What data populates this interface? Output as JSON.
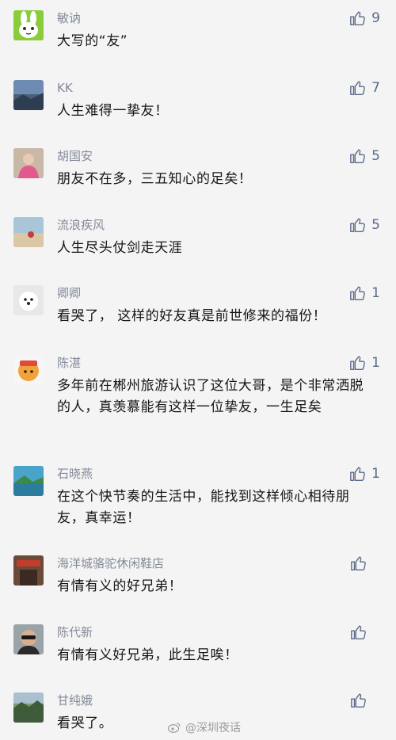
{
  "colors": {
    "background": "#f4f4f4",
    "name": "#848a99",
    "text": "#151515",
    "like": "#5a6a8a"
  },
  "comments": [
    {
      "name": "敏讷",
      "text": "大写的“友”",
      "likes": "9",
      "avatar_icon": "rabbit-avatar"
    },
    {
      "name": "KK",
      "text": "人生难得一挚友！",
      "likes": "7",
      "avatar_icon": "landscape-avatar"
    },
    {
      "name": "胡国安",
      "text": "朋友不在多，三五知心的足矣！",
      "likes": "5",
      "avatar_icon": "person-avatar"
    },
    {
      "name": "流浪疾风",
      "text": "人生尽头仗剑走天涯",
      "likes": "5",
      "avatar_icon": "beach-avatar"
    },
    {
      "name": "卿卿",
      "text": "看哭了，  这样的好友真是前世修来的福份！",
      "likes": "1",
      "avatar_icon": "dog-avatar"
    },
    {
      "name": "陈湛",
      "text": "多年前在郴州旅游认识了这位大哥，是个非常洒脱的人，真羡慕能有这样一位挚友，一生足矣",
      "likes": "1",
      "avatar_icon": "cartoon-avatar"
    },
    {
      "name": "石晓燕",
      "text": "在这个快节奏的生活中，能找到这样倾心相待朋友，真幸运！",
      "likes": "1",
      "avatar_icon": "sea-avatar"
    },
    {
      "name": "海洋城骆驼休闲鞋店",
      "text": "有情有义的好兄弟！",
      "likes": "",
      "avatar_icon": "shop-avatar"
    },
    {
      "name": "陈代新",
      "text": "有情有义好兄弟，此生足唉！",
      "likes": "",
      "avatar_icon": "man-sunglasses-avatar"
    },
    {
      "name": "甘纯娥",
      "text": "看哭了。",
      "likes": "",
      "avatar_icon": "scenery-avatar"
    }
  ],
  "like_icon": "thumbs-up-icon",
  "watermark": {
    "text": "@深圳夜话",
    "icon": "weibo-icon"
  }
}
